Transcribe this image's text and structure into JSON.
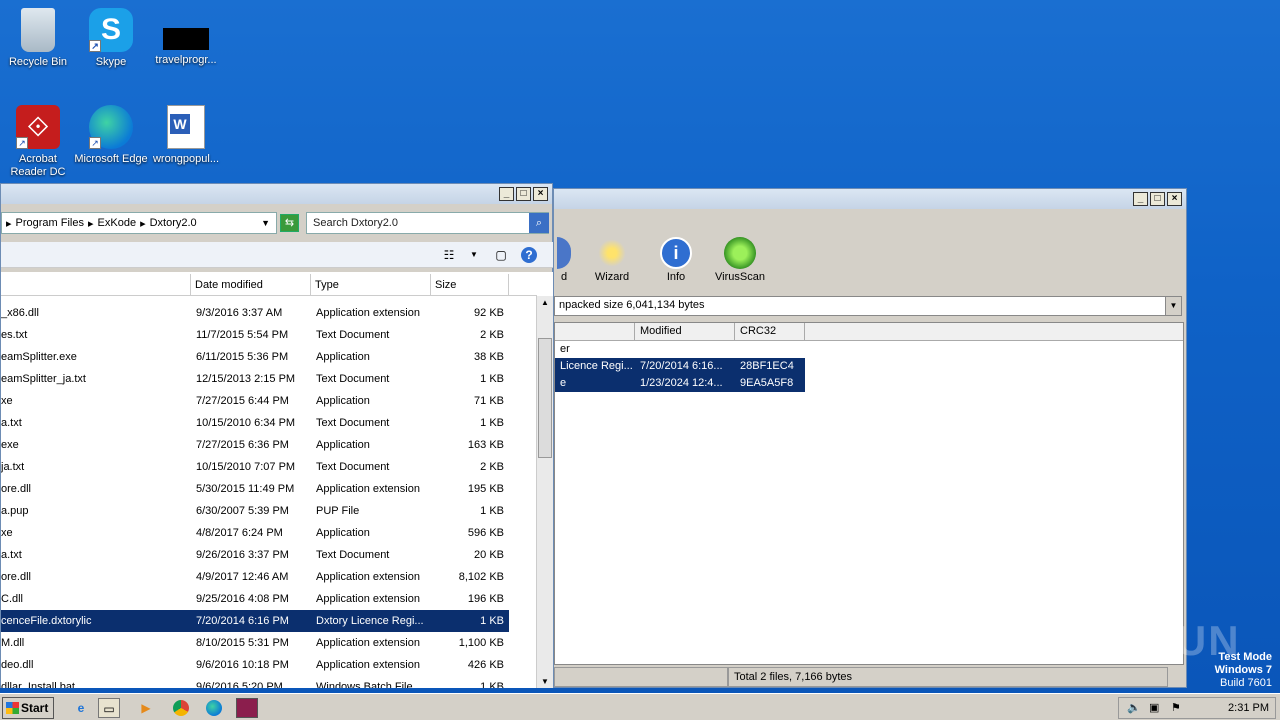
{
  "desktop": {
    "icons": [
      {
        "label": "Recycle Bin"
      },
      {
        "label": "Skype"
      },
      {
        "label": "travelprogr..."
      },
      {
        "label": "Acrobat Reader DC"
      },
      {
        "label": "Microsoft Edge"
      },
      {
        "label": "wrongpopul..."
      }
    ]
  },
  "explorer": {
    "breadcrumb": [
      "Program Files",
      "ExKode",
      "Dxtory2.0"
    ],
    "search_placeholder": "Search Dxtory2.0",
    "columns": [
      "Date modified",
      "Type",
      "Size"
    ],
    "files": [
      {
        "name": "_x86.dll",
        "date": "9/3/2016 3:37 AM",
        "type": "Application extension",
        "size": "92 KB"
      },
      {
        "name": "es.txt",
        "date": "11/7/2015 5:54 PM",
        "type": "Text Document",
        "size": "2 KB"
      },
      {
        "name": "eamSplitter.exe",
        "date": "6/11/2015 5:36 PM",
        "type": "Application",
        "size": "38 KB"
      },
      {
        "name": "eamSplitter_ja.txt",
        "date": "12/15/2013 2:15 PM",
        "type": "Text Document",
        "size": "1 KB"
      },
      {
        "name": "xe",
        "date": "7/27/2015 6:44 PM",
        "type": "Application",
        "size": "71 KB"
      },
      {
        "name": "a.txt",
        "date": "10/15/2010 6:34 PM",
        "type": "Text Document",
        "size": "1 KB"
      },
      {
        "name": "exe",
        "date": "7/27/2015 6:36 PM",
        "type": "Application",
        "size": "163 KB"
      },
      {
        "name": "ja.txt",
        "date": "10/15/2010 7:07 PM",
        "type": "Text Document",
        "size": "2 KB"
      },
      {
        "name": "ore.dll",
        "date": "5/30/2015 11:49 PM",
        "type": "Application extension",
        "size": "195 KB"
      },
      {
        "name": "a.pup",
        "date": "6/30/2007 5:39 PM",
        "type": "PUP File",
        "size": "1 KB"
      },
      {
        "name": "xe",
        "date": "4/8/2017 6:24 PM",
        "type": "Application",
        "size": "596 KB"
      },
      {
        "name": "a.txt",
        "date": "9/26/2016 3:37 PM",
        "type": "Text Document",
        "size": "20 KB"
      },
      {
        "name": "ore.dll",
        "date": "4/9/2017 12:46 AM",
        "type": "Application extension",
        "size": "8,102 KB"
      },
      {
        "name": "C.dll",
        "date": "9/25/2016 4:08 PM",
        "type": "Application extension",
        "size": "196 KB"
      },
      {
        "name": "cenceFile.dxtorylic",
        "date": "7/20/2014 6:16 PM",
        "type": "Dxtory Licence Regi...",
        "size": "1 KB"
      },
      {
        "name": "M.dll",
        "date": "8/10/2015 5:31 PM",
        "type": "Application extension",
        "size": "1,100 KB"
      },
      {
        "name": "deo.dll",
        "date": "9/6/2016 10:18 PM",
        "type": "Application extension",
        "size": "426 KB"
      },
      {
        "name": "dllar_Install.bat",
        "date": "9/6/2016 5:20 PM",
        "type": "Windows Batch File",
        "size": "1 KB"
      }
    ],
    "selected_index": 14
  },
  "winrar": {
    "tools": [
      {
        "label": "d",
        "icon": "find-icon"
      },
      {
        "label": "Wizard",
        "icon": "wand-icon"
      },
      {
        "label": "Info",
        "icon": "info-icon"
      },
      {
        "label": "VirusScan",
        "icon": "bug-icon"
      }
    ],
    "path_text": "npacked size 6,041,134 bytes",
    "columns": [
      "Modified",
      "CRC32"
    ],
    "rows": [
      {
        "name": "er",
        "modified": "",
        "crc": "",
        "selected": false
      },
      {
        "name": "Licence Regi...",
        "modified": "7/20/2014 6:16...",
        "crc": "28BF1EC4",
        "selected": true
      },
      {
        "name": "e",
        "modified": "1/23/2024 12:4...",
        "crc": "9EA5A5F8",
        "selected": true
      }
    ],
    "status": "Total 2 files, 7,166 bytes"
  },
  "taskbar": {
    "start_label": "Start",
    "clock": "2:31 PM"
  },
  "watermark": {
    "line1": "Test Mode",
    "line2": "Windows 7",
    "line3": "Build 7601",
    "brand": "ANY RUN"
  }
}
